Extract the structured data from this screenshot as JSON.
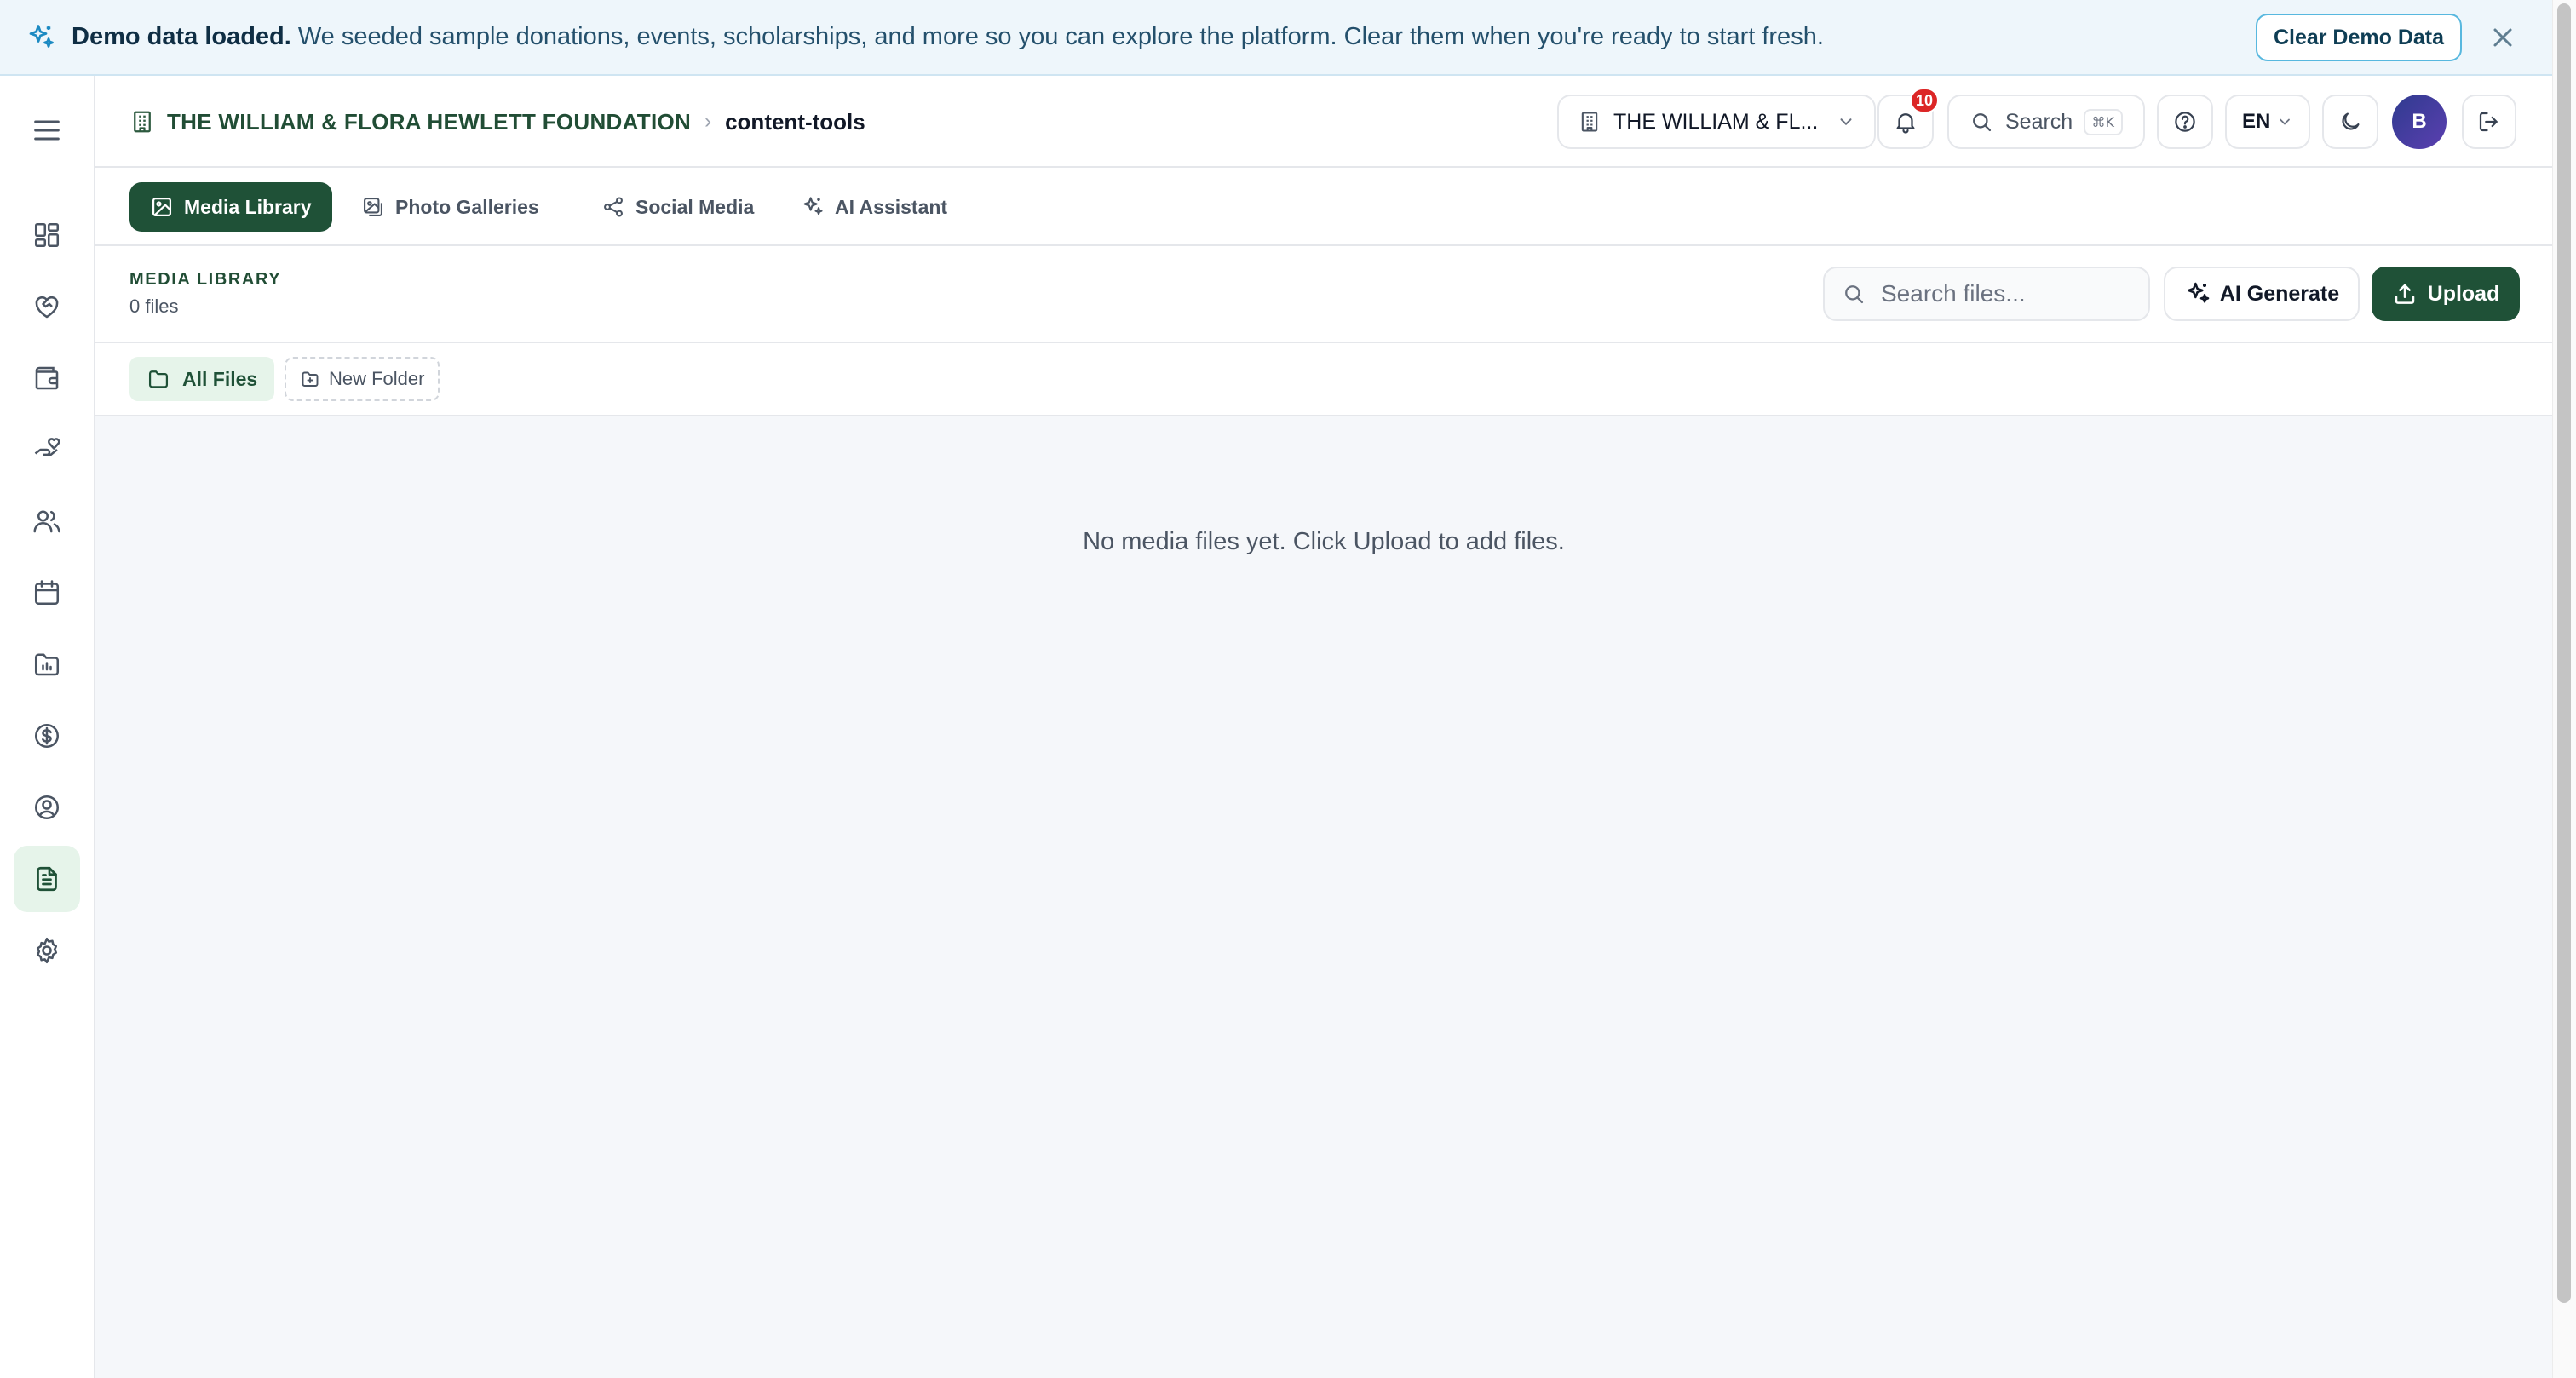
{
  "banner": {
    "title": "Demo data loaded.",
    "message": "We seeded sample donations, events, scholarships, and more so you can explore the platform. Clear them when you're ready to start fresh.",
    "clear_label": "Clear Demo Data"
  },
  "sidebar": {
    "items": [
      "dashboard",
      "donations",
      "wallet",
      "grants",
      "people",
      "calendar",
      "reports",
      "finance",
      "profile",
      "content-tools",
      "settings"
    ],
    "active": "content-tools"
  },
  "header": {
    "org_name": "THE WILLIAM & FLORA HEWLETT FOUNDATION",
    "separator": "›",
    "page": "content-tools",
    "org_select": "THE WILLIAM & FL...",
    "notification_count": "10",
    "search_label": "Search",
    "search_shortcut": "⌘K",
    "language": "EN",
    "avatar_initial": "B"
  },
  "tabs": [
    {
      "label": "Media Library",
      "active": true
    },
    {
      "label": "Photo Galleries",
      "active": false
    },
    {
      "label": "Social Media",
      "active": false
    },
    {
      "label": "AI Assistant",
      "active": false
    }
  ],
  "toolbar": {
    "title": "MEDIA LIBRARY",
    "count": "0 files",
    "search_placeholder": "Search files...",
    "ai_generate_label": "AI Generate",
    "upload_label": "Upload"
  },
  "folders": {
    "all_label": "All Files",
    "new_label": "New Folder"
  },
  "empty_message": "No media files yet. Click Upload to add files.",
  "colors": {
    "brand": "#1f5137",
    "brand_light": "#e6f4ea",
    "banner_bg": "#eef6fb",
    "badge": "#dc2626"
  }
}
